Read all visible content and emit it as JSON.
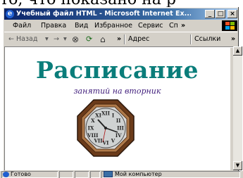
{
  "top_crop_text": "то, что показано на р",
  "window": {
    "title": "Учебный файл HTML - Microsoft Internet Ex...",
    "controls": {
      "minimize": "_",
      "maximize": "□",
      "close": "×"
    }
  },
  "menu": {
    "items": [
      "Файл",
      "Правка",
      "Вид",
      "Избранное",
      "Сервис",
      "Сп"
    ],
    "overflow": "»"
  },
  "toolbar": {
    "back": "← Назад",
    "back_dropdown": "▾",
    "forward": "→",
    "forward_dropdown": "▾",
    "stop": "⊗",
    "refresh": "⟳",
    "home": "⌂",
    "overflow": "»",
    "address_label": "Адрес",
    "links_label": "Ссылки",
    "links_overflow": "»"
  },
  "page": {
    "heading": "Расписание",
    "subheading": "занятий на вторник",
    "clock_numerals": [
      "XII",
      "I",
      "II",
      "III",
      "IV",
      "V",
      "VI",
      "VII",
      "VIII",
      "IX",
      "X",
      "XI"
    ]
  },
  "statusbar": {
    "status": "Готово",
    "zone": "Мой компьютер"
  },
  "scrollbar": {
    "up": "▲",
    "down": "▼"
  }
}
